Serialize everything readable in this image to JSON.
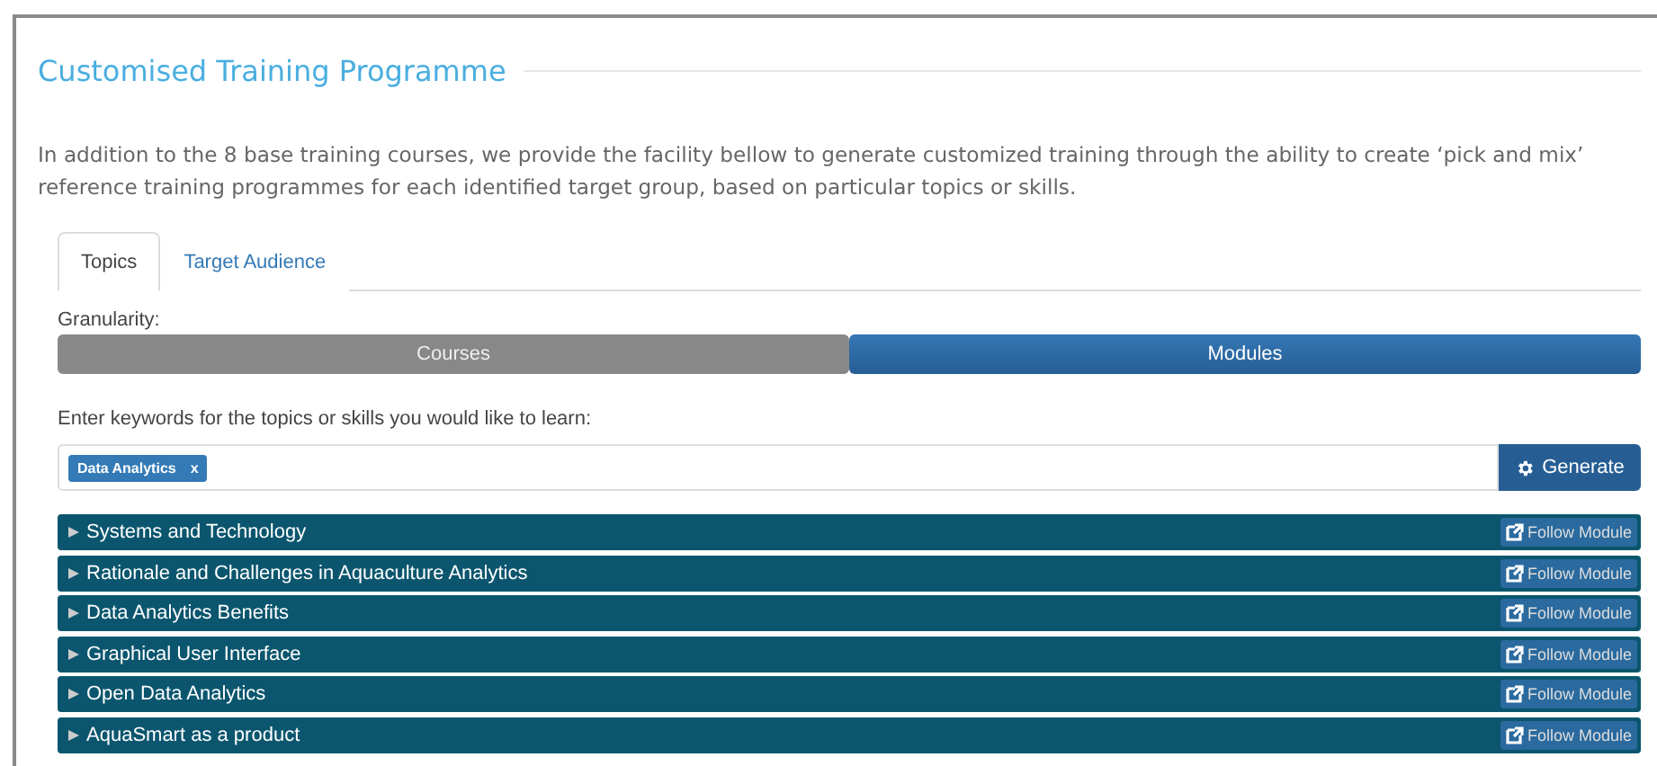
{
  "section": {
    "title": "Customised Training Programme",
    "intro": "In addition to the 8 base training courses, we provide the facility bellow to generate customized training through the ability to create ‘pick and mix’ reference training programmes for each identified target group, based on particular topics or skills."
  },
  "tabs": [
    {
      "label": "Topics",
      "selected": true
    },
    {
      "label": "Target Audience",
      "selected": false
    }
  ],
  "granularity": {
    "label": "Granularity:",
    "options": [
      {
        "label": "Courses",
        "selected": false
      },
      {
        "label": "Modules",
        "selected": true
      }
    ]
  },
  "keywords": {
    "label": "Enter keywords for the topics or skills you would like to learn:",
    "tags": [
      {
        "label": "Data Analytics",
        "remove": "x"
      }
    ],
    "button": "Generate"
  },
  "modules": [
    {
      "title": "Systems and Technology",
      "expanded": false,
      "action": "Follow Module"
    },
    {
      "title": "Rationale and Challenges in Aquaculture Analytics",
      "expanded": false,
      "action": "Follow Module"
    },
    {
      "title": "Data Analytics Benefits",
      "expanded": false,
      "action": "Follow Module"
    },
    {
      "title": "Graphical User Interface",
      "expanded": false,
      "action": "Follow Module"
    },
    {
      "title": "Open Data Analytics",
      "expanded": false,
      "action": "Follow Module"
    },
    {
      "title": "AquaSmart as a product",
      "expanded": false,
      "action": "Follow Module"
    }
  ]
}
